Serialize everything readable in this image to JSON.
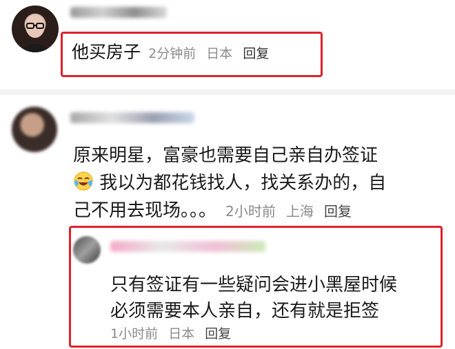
{
  "comments": [
    {
      "text": "他买房子",
      "time": "2分钟前",
      "location": "日本",
      "reply": "回复"
    },
    {
      "lines": [
        "原来明星，富豪也需要自己亲自办签证",
        "我以为都花钱找人，找关系办的，自",
        "己不用去现场。。。"
      ],
      "emoji_icon": "crying-laughing-face-icon",
      "time": "2小时前",
      "location": "上海",
      "reply": "回复"
    }
  ],
  "reply": {
    "lines": [
      "只有签证有一些疑问会进小黑屋时候",
      "必须需要本人亲自，还有就是拒签"
    ],
    "time": "1小时前",
    "location": "日本",
    "reply": "回复"
  },
  "colors": {
    "highlight": "#e0202a",
    "meta": "#8a8a8a"
  }
}
